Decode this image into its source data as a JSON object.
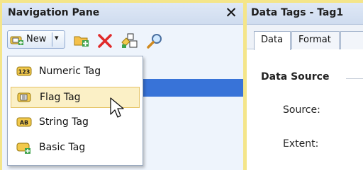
{
  "navigation_pane": {
    "title": "Navigation Pane",
    "close_glyph": "✕",
    "toolbar": {
      "new_label": "New",
      "new_icon": "new-tag-icon",
      "dropdown_caret": "▾",
      "icons": [
        "add-folder-icon",
        "delete-icon",
        "tag-properties-icon",
        "search-icon"
      ]
    },
    "new_menu": {
      "items": [
        {
          "label": "Numeric Tag",
          "icon": "numeric-tag-icon"
        },
        {
          "label": "Flag Tag",
          "icon": "flag-tag-icon",
          "highlighted": true
        },
        {
          "label": "String Tag",
          "icon": "string-tag-icon"
        },
        {
          "label": "Basic Tag",
          "icon": "basic-tag-icon"
        }
      ]
    }
  },
  "data_tags_panel": {
    "title": "Data Tags - Tag1",
    "tabs": [
      "Data",
      "Format"
    ],
    "active_tab": "Data",
    "section_title": "Data Source",
    "fields": [
      {
        "label": "Source:"
      },
      {
        "label": "Extent:"
      }
    ]
  },
  "colors": {
    "frame": "#f4e58a",
    "selection": "#3873d8",
    "menu_highlight": "#fbf0c6"
  }
}
